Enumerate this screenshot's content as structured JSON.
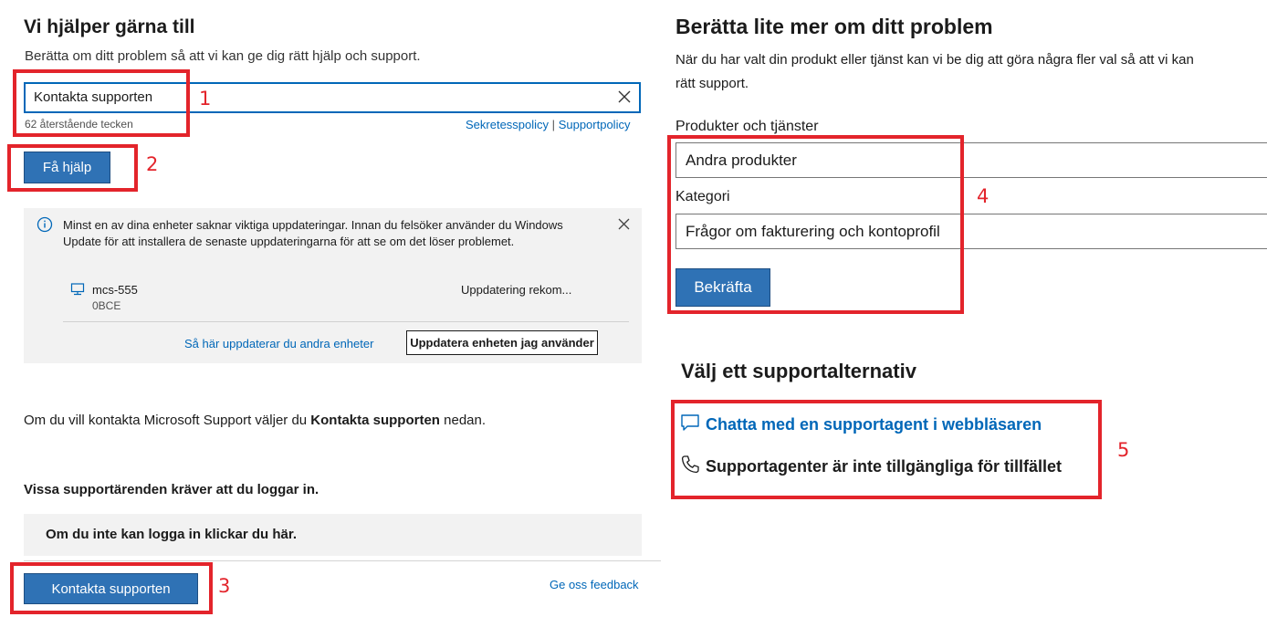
{
  "help_section": {
    "title": "Vi hjälper gärna till",
    "subtitle": "Berätta om ditt problem så att vi kan ge dig rätt hjälp och support.",
    "search_value": "Kontakta supporten",
    "chars_remaining": "62 återstående tecken",
    "privacy_link": "Sekretesspolicy",
    "separator": "|",
    "support_policy_link": "Supportpolicy",
    "get_help_button": "Få hjälp"
  },
  "update_notice": {
    "message": "Minst en av dina enheter saknar viktiga uppdateringar. Innan du felsöker använder du Windows Update för att installera de senaste uppdateringarna för att se om det löser problemet.",
    "device_name": "mcs-555",
    "device_id": "0BCE",
    "status": "Uppdatering rekom...",
    "other_devices_link": "Så här uppdaterar du andra enheter",
    "update_device_button": "Uppdatera enheten jag använder"
  },
  "contact": {
    "info_prefix": "Om du vill kontakta Microsoft Support väljer du ",
    "info_bold": "Kontakta supporten",
    "info_suffix": " nedan.",
    "signin_required": "Vissa supportärenden kräver att du loggar in.",
    "signin_help": "Om du inte kan logga in klickar du här.",
    "contact_button": "Kontakta supporten",
    "feedback_link": "Ge oss feedback"
  },
  "problem_section": {
    "title": "Berätta lite mer om ditt problem",
    "description_line1": "När du har valt din produkt eller tjänst kan vi be dig att göra några fler val så att vi kan",
    "description_line2": "rätt support.",
    "products_label": "Produkter och tjänster",
    "products_value": "Andra produkter",
    "category_label": "Kategori",
    "category_value": "Frågor om fakturering och kontoprofil",
    "confirm_button": "Bekräfta"
  },
  "support_options": {
    "title": "Välj ett supportalternativ",
    "chat_link": "Chatta med en supportagent i webbläsaren",
    "phone_status": "Supportagenter är inte tillgängliga för tillfället"
  },
  "annotations": [
    "1",
    "2",
    "3",
    "4",
    "5"
  ],
  "colors": {
    "accent": "#0067b8",
    "button": "#2f72b5",
    "highlight": "#e3242b",
    "panel": "#f2f2f2"
  },
  "icons": [
    "close-icon",
    "info-icon",
    "computer-icon",
    "chat-icon",
    "phone-icon"
  ]
}
